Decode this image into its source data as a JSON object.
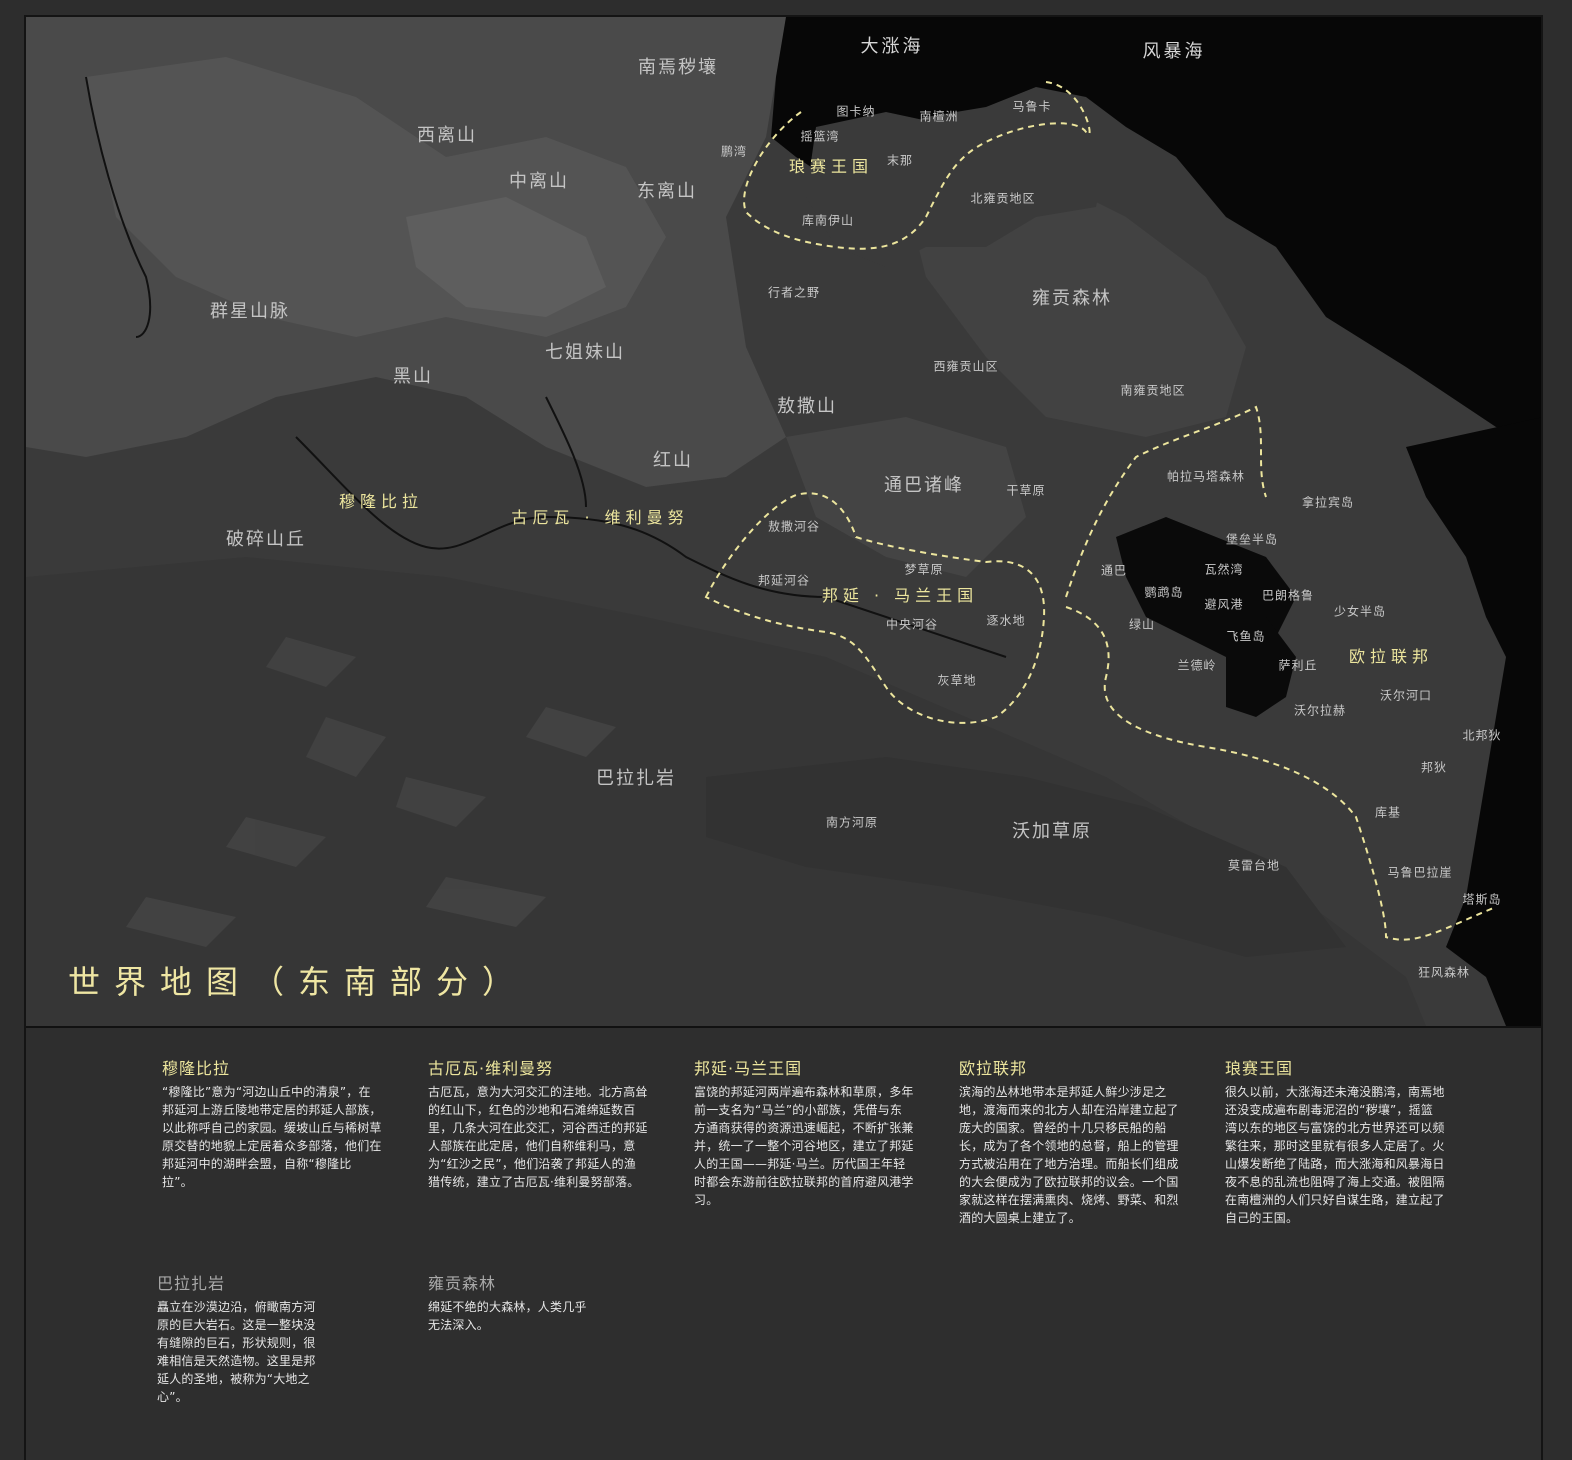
{
  "map": {
    "title": "世界地图（东南部分）",
    "seas": {
      "dazhang": "大涨海",
      "fengbao": "风暴海"
    },
    "regions": {
      "nanyan": "南焉秽壤",
      "xili": "西离山",
      "zhongli": "中离山",
      "dongli": "东离山",
      "qunxing": "群星山脉",
      "qijie": "七姐妹山",
      "heishan": "黑山",
      "aosa": "敖撒山",
      "hongshan": "红山",
      "tongba": "通巴诸峰",
      "posui": "破碎山丘",
      "yonggong": "雍贡森林",
      "bala": "巴拉扎岩",
      "wojia": "沃加草原"
    },
    "kingdoms": {
      "langsai": "琅赛王国",
      "mulong": "穆隆比拉",
      "gueva": "古厄瓦 · 维利曼努",
      "bangyan": "邦延 · 马兰王国",
      "oula": "欧拉联邦"
    },
    "places": {
      "tukana": "图卡纳",
      "nantan": "南檀洲",
      "maluka": "马鲁卡",
      "yaolan": "摇篮湾",
      "pengwan": "鹏湾",
      "mona": "末那",
      "beiyong": "北雍贡地区",
      "kunan": "库南伊山",
      "xingzhe": "行者之野",
      "xiyong": "西雍贡山区",
      "nanyong": "南雍贡地区",
      "ganchao": "干草原",
      "pala": "帕拉马塔森林",
      "nala": "拿拉宾岛",
      "baolei": "堡垒半岛",
      "aosagu": "敖撒河谷",
      "mengcao": "梦草原",
      "bangyangu": "邦延河谷",
      "zhongyang": "中央河谷",
      "zhushui": "逐水地",
      "huicao": "灰草地",
      "tongbap": "通巴",
      "waran": "瓦然湾",
      "yingwu": "鹦鹉岛",
      "bifeng": "避风港",
      "balang": "巴朗格鲁",
      "shaonv": "少女半岛",
      "lvshan": "绿山",
      "feiyu": "飞鱼岛",
      "lande": "兰德岭",
      "saliqiu": "萨利丘",
      "woerkou": "沃尔河口",
      "woerla": "沃尔拉赫",
      "beibang": "北邦狄",
      "bangdi": "邦狄",
      "kuji": "库基",
      "nanfang": "南方河原",
      "molei": "莫雷台地",
      "malula": "马鲁巴拉崖",
      "tasi": "塔斯岛",
      "kuangfeng": "狂风森林"
    }
  },
  "cards": [
    {
      "title": "穆隆比拉",
      "body": "“穆隆比”意为“河边山丘中的清泉”，在邦延河上游丘陵地带定居的邦延人部族，以此称呼自己的家园。缓坡山丘与稀树草原交替的地貌上定居着众多部落，他们在邦延河中的湖畔会盟，自称“穆隆比拉”。"
    },
    {
      "title": "古厄瓦·维利曼努",
      "body": "古厄瓦，意为大河交汇的洼地。北方高耸的红山下，红色的沙地和石滩绵延数百里，几条大河在此交汇，河谷西迁的邦延人部族在此定居，他们自称维利马，意为“红沙之民”，他们沿袭了邦延人的渔猎传统，建立了古厄瓦·维利曼努部落。"
    },
    {
      "title": "邦延·马兰王国",
      "body": "富饶的邦延河两岸遍布森林和草原，多年前一支名为“马兰”的小部族，凭借与东方通商获得的资源迅速崛起，不断扩张兼并，统一了一整个河谷地区，建立了邦延人的王国——邦延·马兰。历代国王年轻时都会东游前往欧拉联邦的首府避风港学习。"
    },
    {
      "title": "欧拉联邦",
      "body": "滨海的丛林地带本是邦延人鲜少涉足之地，渡海而来的北方人却在沿岸建立起了庞大的国家。曾经的十几只移民船的船长，成为了各个领地的总督，船上的管理方式被沿用在了地方治理。而船长们组成的大会便成为了欧拉联邦的议会。一个国家就这样在摆满熏肉、烧烤、野菜、和烈酒的大圆桌上建立了。"
    },
    {
      "title": "琅赛王国",
      "body": "很久以前，大涨海还未淹没鹏湾，南焉地还没变成遍布剧毒泥沼的“秽壤”，摇篮湾以东的地区与富饶的北方世界还可以频繁往来，那时这里就有很多人定居了。火山爆发断绝了陆路，而大涨海和风暴海日夜不息的乱流也阻碍了海上交通。被阻隔在南檀洲的人们只好自谋生路，建立起了自己的王国。"
    },
    {
      "title": "巴拉扎岩",
      "body": "矗立在沙漠边沿，俯瞰南方河原的巨大岩石。这是一整块没有缝隙的巨石，形状规则，很难相信是天然造物。这里是邦延人的圣地，被称为“大地之心”。"
    },
    {
      "title": "雍贡森林",
      "body": "绵延不绝的大森林，人类几乎无法深入。"
    }
  ]
}
